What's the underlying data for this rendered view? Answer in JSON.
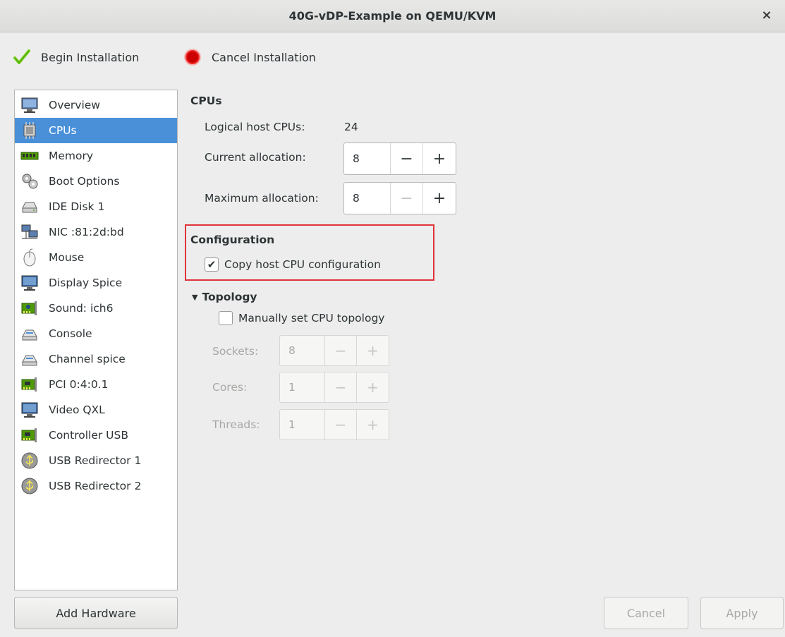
{
  "window": {
    "title": "40G-vDP-Example on QEMU/KVM",
    "close_label": "×"
  },
  "toolbar": {
    "begin_label": "Begin Installation",
    "cancel_label": "Cancel Installation",
    "begin_icon": "checkmark-icon",
    "cancel_icon": "stop-icon",
    "begin_color": "#73d216",
    "cancel_color": "#cc0000"
  },
  "sidebar": {
    "items": [
      {
        "label": "Overview",
        "icon": "monitor-icon"
      },
      {
        "label": "CPUs",
        "icon": "cpu-chip-icon",
        "selected": true
      },
      {
        "label": "Memory",
        "icon": "memory-icon"
      },
      {
        "label": "Boot Options",
        "icon": "gears-icon"
      },
      {
        "label": "IDE Disk 1",
        "icon": "disk-icon"
      },
      {
        "label": "NIC :81:2d:bd",
        "icon": "network-icon"
      },
      {
        "label": "Mouse",
        "icon": "mouse-icon"
      },
      {
        "label": "Display Spice",
        "icon": "display-icon"
      },
      {
        "label": "Sound: ich6",
        "icon": "sound-card-icon"
      },
      {
        "label": "Console",
        "icon": "console-icon"
      },
      {
        "label": "Channel spice",
        "icon": "channel-icon"
      },
      {
        "label": "PCI 0:4:0.1",
        "icon": "pci-card-icon"
      },
      {
        "label": "Video QXL",
        "icon": "video-icon"
      },
      {
        "label": "Controller USB",
        "icon": "controller-icon"
      },
      {
        "label": "USB Redirector 1",
        "icon": "usb-icon"
      },
      {
        "label": "USB Redirector 2",
        "icon": "usb-icon"
      }
    ],
    "selected_color": "#4a90d9",
    "add_hardware_label": "Add Hardware"
  },
  "cpus": {
    "section_title": "CPUs",
    "logical_label": "Logical host CPUs:",
    "logical_value": "24",
    "current_label": "Current allocation:",
    "current_value": "8",
    "max_label": "Maximum allocation:",
    "max_value": "8",
    "minus": "−",
    "plus": "+"
  },
  "configuration": {
    "title": "Configuration",
    "copy_host_label": "Copy host CPU configuration",
    "copy_host_checked": true,
    "highlight_color": "#e0343a"
  },
  "topology": {
    "title": "Topology",
    "manual_label": "Manually set CPU topology",
    "manual_checked": false,
    "sockets_label": "Sockets:",
    "sockets_value": "8",
    "cores_label": "Cores:",
    "cores_value": "1",
    "threads_label": "Threads:",
    "threads_value": "1"
  },
  "buttons": {
    "cancel_label": "Cancel",
    "apply_label": "Apply"
  }
}
